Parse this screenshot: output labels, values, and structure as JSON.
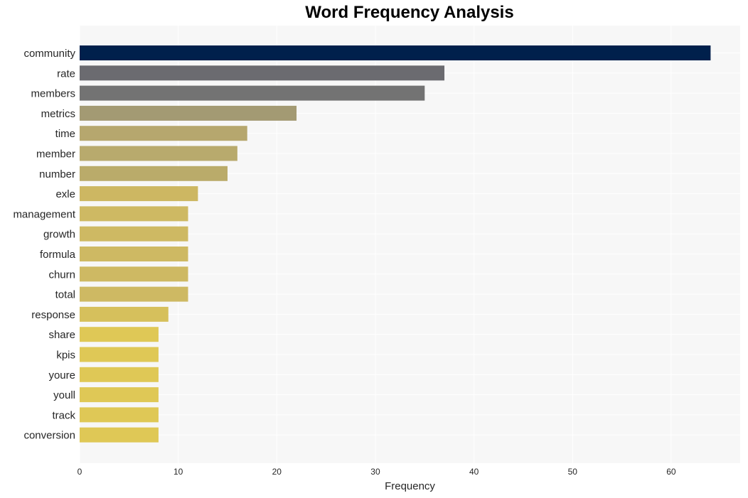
{
  "chart_data": {
    "type": "bar",
    "orientation": "horizontal",
    "title": "Word Frequency Analysis",
    "xlabel": "Frequency",
    "ylabel": "",
    "xlim": [
      0,
      67
    ],
    "xticks": [
      0,
      10,
      20,
      30,
      40,
      50,
      60
    ],
    "grid": true,
    "categories": [
      "community",
      "rate",
      "members",
      "metrics",
      "time",
      "member",
      "number",
      "exle",
      "management",
      "growth",
      "formula",
      "churn",
      "total",
      "response",
      "share",
      "kpis",
      "youre",
      "youll",
      "track",
      "conversion"
    ],
    "values": [
      64,
      37,
      35,
      22,
      17,
      16,
      15,
      12,
      11,
      11,
      11,
      11,
      11,
      9,
      8,
      8,
      8,
      8,
      8,
      8
    ],
    "colors": [
      "#00204c",
      "#6b6b70",
      "#737373",
      "#a39a73",
      "#b6a76e",
      "#b8aa6d",
      "#baab6a",
      "#cdb762",
      "#ceb963",
      "#ceb963",
      "#ceb963",
      "#ceb963",
      "#ceb963",
      "#d6c05c",
      "#dfc856",
      "#dfc856",
      "#dfc856",
      "#dfc856",
      "#dfc856",
      "#dfc856"
    ]
  },
  "colors": {
    "plot_background": "#f7f7f7",
    "grid": "#ffffff"
  }
}
